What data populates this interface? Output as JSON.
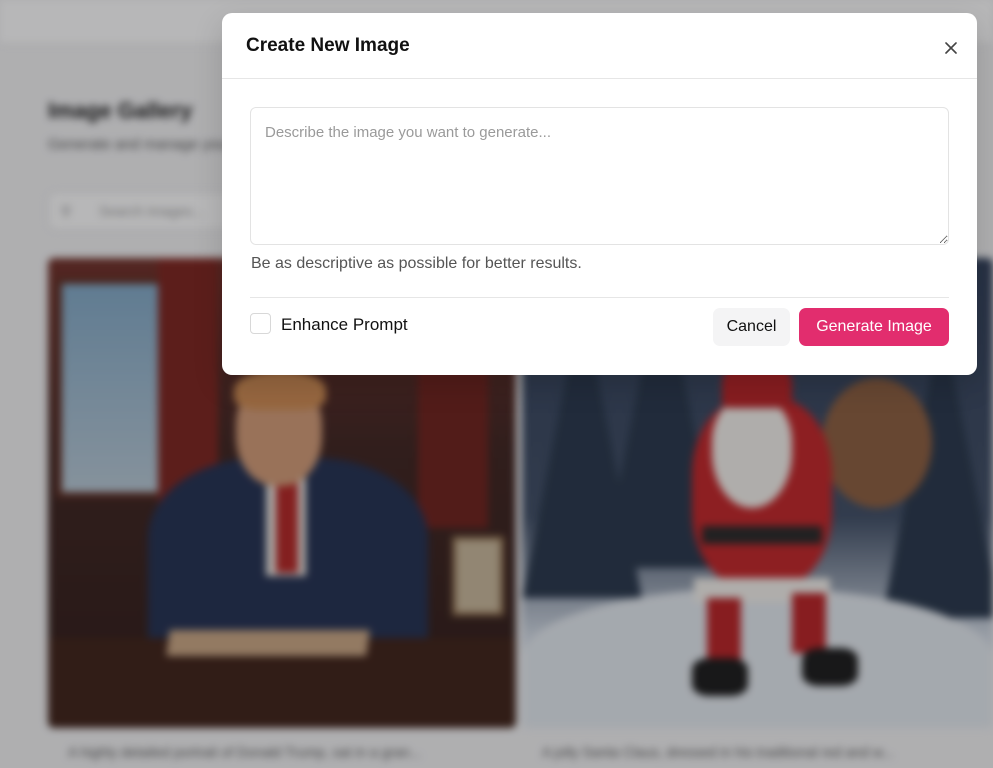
{
  "background": {
    "gallery_title": "Image Gallery",
    "gallery_subtitle": "Generate and manage your images",
    "search_placeholder": "Search images...",
    "search_icon": "search-icon",
    "cards": [
      {
        "caption": "A highly detailed portrait of Donald Trump, sat in a gran..."
      },
      {
        "caption": "A jolly Santa Claus, dressed in his traditional red and w..."
      }
    ]
  },
  "modal": {
    "title": "Create New Image",
    "close_icon": "close-icon",
    "prompt_placeholder": "Describe the image you want to generate...",
    "prompt_value": "",
    "hint": "Be as descriptive as possible for better results.",
    "enhance_label": "Enhance Prompt",
    "enhance_checked": false,
    "cancel_label": "Cancel",
    "generate_label": "Generate Image"
  },
  "colors": {
    "accent": "#e22d6e",
    "overlay": "rgba(30,30,35,0.32)",
    "cancel_bg": "#f4f4f5"
  }
}
